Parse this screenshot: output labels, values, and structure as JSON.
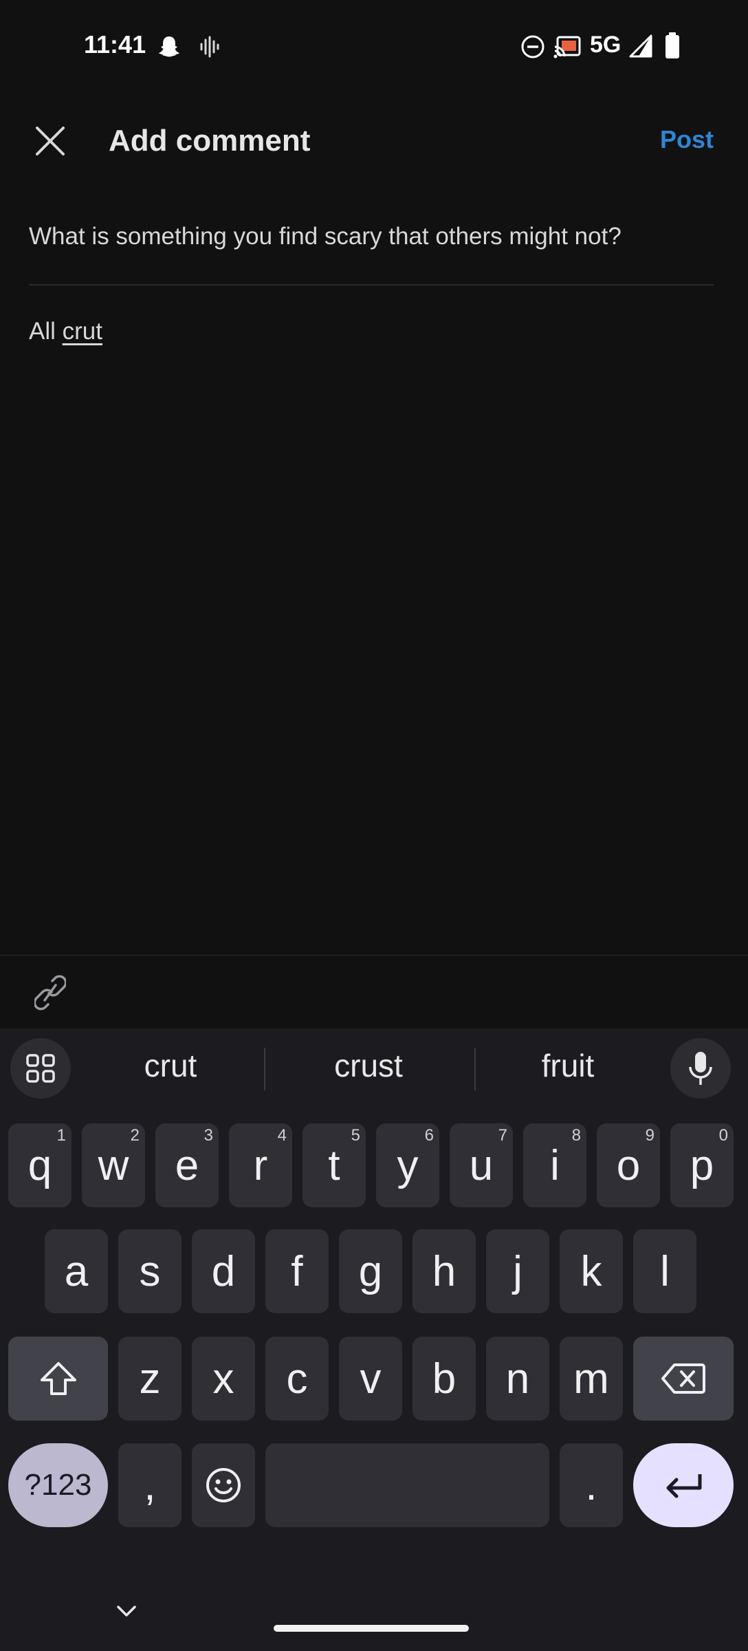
{
  "status_bar": {
    "time": "11:41",
    "network": "5G",
    "icons": [
      "snapchat-icon",
      "audio-icon",
      "dnd-icon",
      "cast-icon",
      "signal-icon",
      "battery-icon"
    ]
  },
  "header": {
    "title": "Add comment",
    "post_label": "Post"
  },
  "post": {
    "title": "What is something you find scary that others might not?"
  },
  "comment": {
    "text_before": "All ",
    "composing_word": "crut"
  },
  "keyboard": {
    "suggestions": [
      "crut",
      "crust",
      "fruit"
    ],
    "row1": [
      {
        "k": "q",
        "n": "1"
      },
      {
        "k": "w",
        "n": "2"
      },
      {
        "k": "e",
        "n": "3"
      },
      {
        "k": "r",
        "n": "4"
      },
      {
        "k": "t",
        "n": "5"
      },
      {
        "k": "y",
        "n": "6"
      },
      {
        "k": "u",
        "n": "7"
      },
      {
        "k": "i",
        "n": "8"
      },
      {
        "k": "o",
        "n": "9"
      },
      {
        "k": "p",
        "n": "0"
      }
    ],
    "row2": [
      "a",
      "s",
      "d",
      "f",
      "g",
      "h",
      "j",
      "k",
      "l"
    ],
    "row3": [
      "z",
      "x",
      "c",
      "v",
      "b",
      "n",
      "m"
    ],
    "symbols_label": "?123",
    "comma_label": ",",
    "period_label": "."
  },
  "colors": {
    "background": "#111112",
    "accent": "#2f86d6",
    "keyboard_bg": "#1c1c20",
    "key_bg": "#2f2f35",
    "enter_bg": "#e6e0ff"
  }
}
